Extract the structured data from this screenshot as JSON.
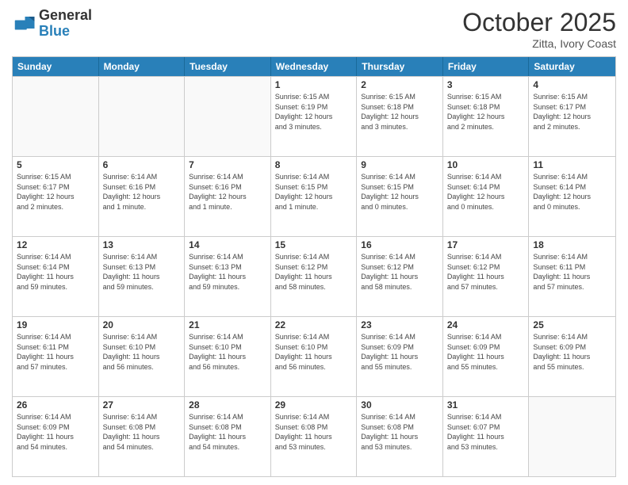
{
  "logo": {
    "general": "General",
    "blue": "Blue"
  },
  "title": "October 2025",
  "subtitle": "Zitta, Ivory Coast",
  "days": [
    "Sunday",
    "Monday",
    "Tuesday",
    "Wednesday",
    "Thursday",
    "Friday",
    "Saturday"
  ],
  "rows": [
    [
      {
        "num": "",
        "info": ""
      },
      {
        "num": "",
        "info": ""
      },
      {
        "num": "",
        "info": ""
      },
      {
        "num": "1",
        "info": "Sunrise: 6:15 AM\nSunset: 6:19 PM\nDaylight: 12 hours\nand 3 minutes."
      },
      {
        "num": "2",
        "info": "Sunrise: 6:15 AM\nSunset: 6:18 PM\nDaylight: 12 hours\nand 3 minutes."
      },
      {
        "num": "3",
        "info": "Sunrise: 6:15 AM\nSunset: 6:18 PM\nDaylight: 12 hours\nand 2 minutes."
      },
      {
        "num": "4",
        "info": "Sunrise: 6:15 AM\nSunset: 6:17 PM\nDaylight: 12 hours\nand 2 minutes."
      }
    ],
    [
      {
        "num": "5",
        "info": "Sunrise: 6:15 AM\nSunset: 6:17 PM\nDaylight: 12 hours\nand 2 minutes."
      },
      {
        "num": "6",
        "info": "Sunrise: 6:14 AM\nSunset: 6:16 PM\nDaylight: 12 hours\nand 1 minute."
      },
      {
        "num": "7",
        "info": "Sunrise: 6:14 AM\nSunset: 6:16 PM\nDaylight: 12 hours\nand 1 minute."
      },
      {
        "num": "8",
        "info": "Sunrise: 6:14 AM\nSunset: 6:15 PM\nDaylight: 12 hours\nand 1 minute."
      },
      {
        "num": "9",
        "info": "Sunrise: 6:14 AM\nSunset: 6:15 PM\nDaylight: 12 hours\nand 0 minutes."
      },
      {
        "num": "10",
        "info": "Sunrise: 6:14 AM\nSunset: 6:14 PM\nDaylight: 12 hours\nand 0 minutes."
      },
      {
        "num": "11",
        "info": "Sunrise: 6:14 AM\nSunset: 6:14 PM\nDaylight: 12 hours\nand 0 minutes."
      }
    ],
    [
      {
        "num": "12",
        "info": "Sunrise: 6:14 AM\nSunset: 6:14 PM\nDaylight: 11 hours\nand 59 minutes."
      },
      {
        "num": "13",
        "info": "Sunrise: 6:14 AM\nSunset: 6:13 PM\nDaylight: 11 hours\nand 59 minutes."
      },
      {
        "num": "14",
        "info": "Sunrise: 6:14 AM\nSunset: 6:13 PM\nDaylight: 11 hours\nand 59 minutes."
      },
      {
        "num": "15",
        "info": "Sunrise: 6:14 AM\nSunset: 6:12 PM\nDaylight: 11 hours\nand 58 minutes."
      },
      {
        "num": "16",
        "info": "Sunrise: 6:14 AM\nSunset: 6:12 PM\nDaylight: 11 hours\nand 58 minutes."
      },
      {
        "num": "17",
        "info": "Sunrise: 6:14 AM\nSunset: 6:12 PM\nDaylight: 11 hours\nand 57 minutes."
      },
      {
        "num": "18",
        "info": "Sunrise: 6:14 AM\nSunset: 6:11 PM\nDaylight: 11 hours\nand 57 minutes."
      }
    ],
    [
      {
        "num": "19",
        "info": "Sunrise: 6:14 AM\nSunset: 6:11 PM\nDaylight: 11 hours\nand 57 minutes."
      },
      {
        "num": "20",
        "info": "Sunrise: 6:14 AM\nSunset: 6:10 PM\nDaylight: 11 hours\nand 56 minutes."
      },
      {
        "num": "21",
        "info": "Sunrise: 6:14 AM\nSunset: 6:10 PM\nDaylight: 11 hours\nand 56 minutes."
      },
      {
        "num": "22",
        "info": "Sunrise: 6:14 AM\nSunset: 6:10 PM\nDaylight: 11 hours\nand 56 minutes."
      },
      {
        "num": "23",
        "info": "Sunrise: 6:14 AM\nSunset: 6:09 PM\nDaylight: 11 hours\nand 55 minutes."
      },
      {
        "num": "24",
        "info": "Sunrise: 6:14 AM\nSunset: 6:09 PM\nDaylight: 11 hours\nand 55 minutes."
      },
      {
        "num": "25",
        "info": "Sunrise: 6:14 AM\nSunset: 6:09 PM\nDaylight: 11 hours\nand 55 minutes."
      }
    ],
    [
      {
        "num": "26",
        "info": "Sunrise: 6:14 AM\nSunset: 6:09 PM\nDaylight: 11 hours\nand 54 minutes."
      },
      {
        "num": "27",
        "info": "Sunrise: 6:14 AM\nSunset: 6:08 PM\nDaylight: 11 hours\nand 54 minutes."
      },
      {
        "num": "28",
        "info": "Sunrise: 6:14 AM\nSunset: 6:08 PM\nDaylight: 11 hours\nand 54 minutes."
      },
      {
        "num": "29",
        "info": "Sunrise: 6:14 AM\nSunset: 6:08 PM\nDaylight: 11 hours\nand 53 minutes."
      },
      {
        "num": "30",
        "info": "Sunrise: 6:14 AM\nSunset: 6:08 PM\nDaylight: 11 hours\nand 53 minutes."
      },
      {
        "num": "31",
        "info": "Sunrise: 6:14 AM\nSunset: 6:07 PM\nDaylight: 11 hours\nand 53 minutes."
      },
      {
        "num": "",
        "info": ""
      }
    ]
  ]
}
